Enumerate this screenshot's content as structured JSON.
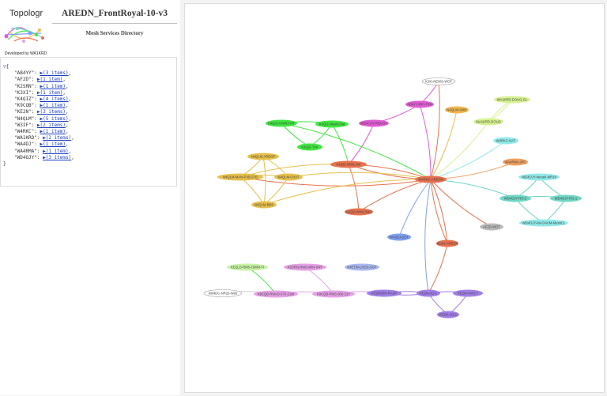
{
  "header": {
    "logo_title": "Topologr",
    "developed_by": "Developed by WA1KRD",
    "app_title": "AREDN_FrontRoyal-10-v3",
    "subtitle": "Mesh Services Directory"
  },
  "json_view": {
    "open_label": "{",
    "close_label": "}",
    "entries": [
      {
        "key": "\"AB4YY\":",
        "value": "(3 items)"
      },
      {
        "key": "\"AF2D\":",
        "value": "(1 item)"
      },
      {
        "key": "\"K2SRN\":",
        "value": "(1 item)"
      },
      {
        "key": "\"K3XI\":",
        "value": "(1 item)"
      },
      {
        "key": "\"K4QIZ\":",
        "value": "(4 items)"
      },
      {
        "key": "\"K9CQB\":",
        "value": "(1 item)"
      },
      {
        "key": "\"KE2N\":",
        "value": "(3 items)"
      },
      {
        "key": "\"N4QLM\":",
        "value": "(5 items)"
      },
      {
        "key": "\"W3IF\":",
        "value": "(2 items)"
      },
      {
        "key": "\"W4RKC\":",
        "value": "(1 item)"
      },
      {
        "key": "\"WA1KRD\":",
        "value": "(2 items)"
      },
      {
        "key": "\"WA4DJ\":",
        "value": "(1 item)"
      },
      {
        "key": "\"WA4RMA\":",
        "value": "(1 item)"
      },
      {
        "key": "\"WD4OJY\":",
        "value": "(3 items)"
      }
    ]
  },
  "graph": {
    "nodes": [
      {
        "id": "hub",
        "label": "W4RKC-AREDN",
        "color": "#e8714d"
      },
      {
        "id": "k3xi",
        "label": "K3XI-NEWS-WOT",
        "color": "#ffffff"
      },
      {
        "id": "ab4",
        "label": "AB4YY-RPI-TSN",
        "color": "#e35ad6"
      },
      {
        "id": "n4ah",
        "label": "N4QLM-SMD",
        "color": "#f2b84d"
      },
      {
        "id": "wa1",
        "label": "WA1KRD-DOUG-GL",
        "color": "#d6f28f"
      },
      {
        "id": "wa1b",
        "label": "WA1KRD-DOUG",
        "color": "#d6f28f"
      },
      {
        "id": "wd3",
        "label": "WD4OJY-PBX-DT",
        "color": "#e35ad6"
      },
      {
        "id": "g1",
        "label": "K4QIZ-HAMCHAT",
        "color": "#3ee83e"
      },
      {
        "id": "g2",
        "label": "K4QIZ-MeshChat",
        "color": "#3ee83e"
      },
      {
        "id": "g3",
        "label": "K4QIZ-TAK",
        "color": "#3ee83e"
      },
      {
        "id": "w4n",
        "label": "W4RKC-NAT",
        "color": "#92eaea"
      },
      {
        "id": "wa4",
        "label": "WA4RMA-IRC",
        "color": "#f2a060"
      },
      {
        "id": "lh",
        "label": "K4QIZ-WINLINK",
        "color": "#e8714d"
      },
      {
        "id": "y1",
        "label": "N4QLM-ARDOP",
        "color": "#e6c04a"
      },
      {
        "id": "y2",
        "label": "N4QLM-MAN-PXB-2TB",
        "color": "#e6c04a"
      },
      {
        "id": "y3",
        "label": "N4QLM-CHAT",
        "color": "#e6c04a"
      },
      {
        "id": "y4",
        "label": "N4QLM-BBS",
        "color": "#e6c04a"
      },
      {
        "id": "t1",
        "label": "WD4OJY-Meraki-MR18",
        "color": "#92eaea"
      },
      {
        "id": "t2",
        "label": "WD4OJY-RO-2",
        "color": "#6fd6c6"
      },
      {
        "id": "t3",
        "label": "WD4OJY-RO-1",
        "color": "#6fd6c6"
      },
      {
        "id": "t4",
        "label": "WD4OJY-MAGNUM-MeshCL",
        "color": "#92eaea"
      },
      {
        "id": "wl",
        "label": "K4QIZ-WINLINK2",
        "color": "#e8714d"
      },
      {
        "id": "af2d",
        "label": "AF2D-WOT",
        "color": "#bbbbbb"
      },
      {
        "id": "wa4dj",
        "label": "WA4DJ-SOT",
        "color": "#7f9ff2"
      },
      {
        "id": "ke",
        "label": "KE2N-AREDN",
        "color": "#e8714d"
      },
      {
        "id": "kg",
        "label": "KD1LO-RMS-OMNI-TI",
        "color": "#c6f2a4"
      },
      {
        "id": "k2s",
        "label": "K2SRN-RMS-WIN-SNT",
        "color": "#e6a0e6"
      },
      {
        "id": "k4et",
        "label": "K4ETW-LHOS-SOT",
        "color": "#aab8f2"
      },
      {
        "id": "km4",
        "label": "KM4DC-NR25-Web",
        "color": "#ffffff"
      },
      {
        "id": "kw1",
        "label": "K9CQB-RMAD-570-21W",
        "color": "#e6a0e6"
      },
      {
        "id": "kw2",
        "label": "K9CQB-RMS-360-21Y",
        "color": "#e6a0e6"
      },
      {
        "id": "kz1",
        "label": "KE2N-BIN-RASP",
        "color": "#a07ee8"
      },
      {
        "id": "kz2",
        "label": "KE2N-AD-1",
        "color": "#a07ee8"
      },
      {
        "id": "kz3",
        "label": "KE2N-HAPLY",
        "color": "#a07ee8"
      },
      {
        "id": "kz4",
        "label": "KE2N-AD-2",
        "color": "#a07ee8"
      }
    ]
  }
}
